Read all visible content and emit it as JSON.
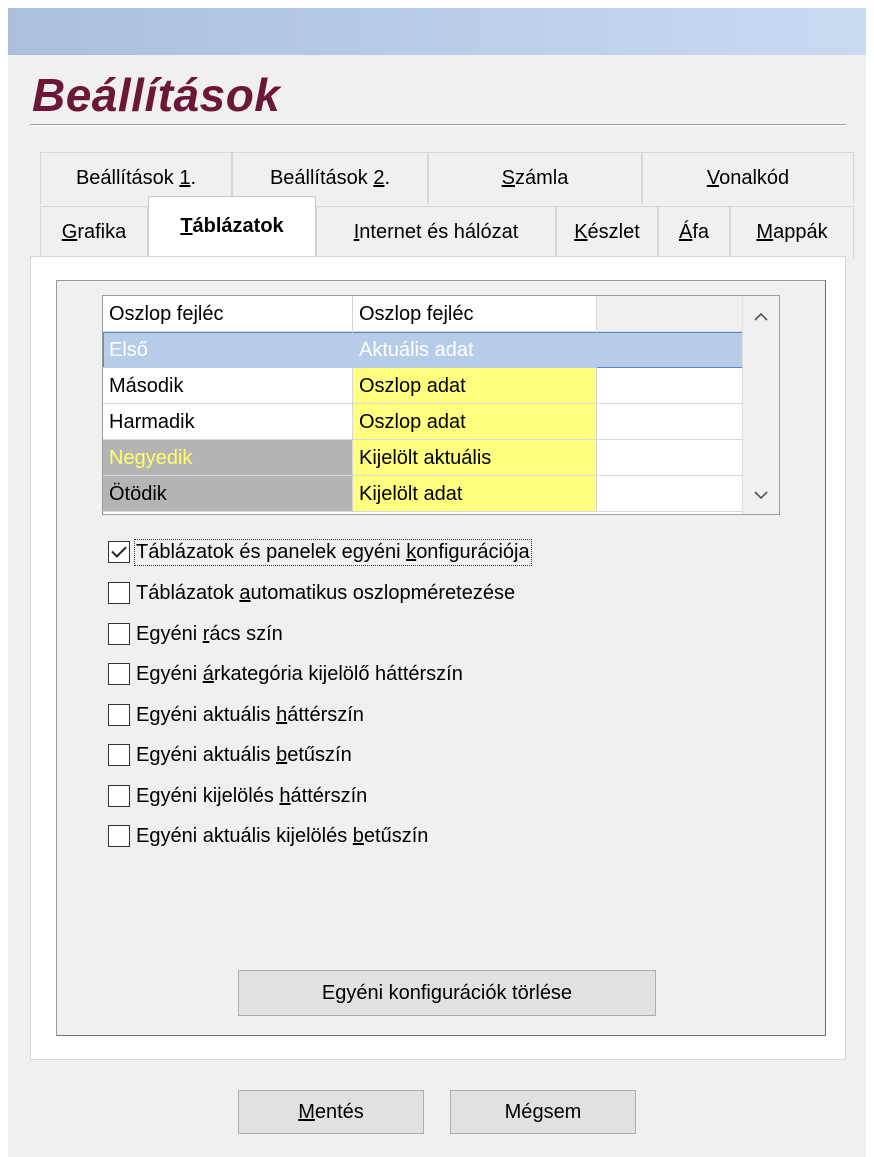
{
  "window": {
    "title": "Beállítások"
  },
  "tabs": {
    "row1": [
      {
        "pre": "Beállítások ",
        "u": "1",
        "post": "."
      },
      {
        "pre": "Beállítások ",
        "u": "2",
        "post": "."
      },
      {
        "pre": "",
        "u": "S",
        "post": "zámla"
      },
      {
        "pre": "",
        "u": "V",
        "post": "onalkód"
      }
    ],
    "row2": [
      {
        "pre": "",
        "u": "G",
        "post": "rafika"
      },
      {
        "pre": "",
        "u": "T",
        "post": "áblázatok"
      },
      {
        "pre": "",
        "u": "I",
        "post": "nternet és hálózat"
      },
      {
        "pre": "",
        "u": "K",
        "post": "észlet"
      },
      {
        "pre": "",
        "u": "Á",
        "post": "fa"
      },
      {
        "pre": "",
        "u": "M",
        "post": "appák"
      }
    ],
    "active": "Táblázatok"
  },
  "grid": {
    "rows": [
      {
        "name": "Oszlop fejléc",
        "value": "Oszlop fejléc"
      },
      {
        "name": "Első",
        "value": "Aktuális adat"
      },
      {
        "name": "Második",
        "value": "Oszlop adat"
      },
      {
        "name": "Harmadik",
        "value": "Oszlop adat"
      },
      {
        "name": "Negyedik",
        "value": "Kijelölt aktuális"
      },
      {
        "name": "Ötödik",
        "value": "Kijelölt adat"
      }
    ]
  },
  "options": [
    {
      "pre": "Táblázatok és panelek egyéni ",
      "u": "k",
      "post": "onfigurációja",
      "checked": true
    },
    {
      "pre": "Táblázatok ",
      "u": "a",
      "post": "utomatikus oszlopméretezése",
      "checked": false
    },
    {
      "pre": "Egyéni ",
      "u": "r",
      "post": "ács szín",
      "checked": false
    },
    {
      "pre": "Egyéni ",
      "u": "á",
      "post": "rkategória kijelölő háttérszín",
      "checked": false
    },
    {
      "pre": "Egyéni aktuális ",
      "u": "h",
      "post": "áttérszín",
      "checked": false
    },
    {
      "pre": "Egyéni aktuális ",
      "u": "b",
      "post": "etűszín",
      "checked": false
    },
    {
      "pre": "Egyéni kijelölés ",
      "u": "h",
      "post": "áttérszín",
      "checked": false
    },
    {
      "pre": "Egyéni aktuális kijelölés ",
      "u": "b",
      "post": "etűszín",
      "checked": false
    }
  ],
  "buttons": {
    "clear_custom": "Egyéni konfigurációk törlése",
    "save": {
      "pre": "",
      "u": "M",
      "post": "entés"
    },
    "cancel": {
      "pre": "Mé",
      "u": "g",
      "post": "sem"
    }
  },
  "colors": {
    "title": "#6d1738",
    "selected_row": "#b6cce8",
    "yellow_cell": "#ffff80",
    "gray_cell": "#b4b4b4",
    "yellow_text": "#ffff66"
  }
}
